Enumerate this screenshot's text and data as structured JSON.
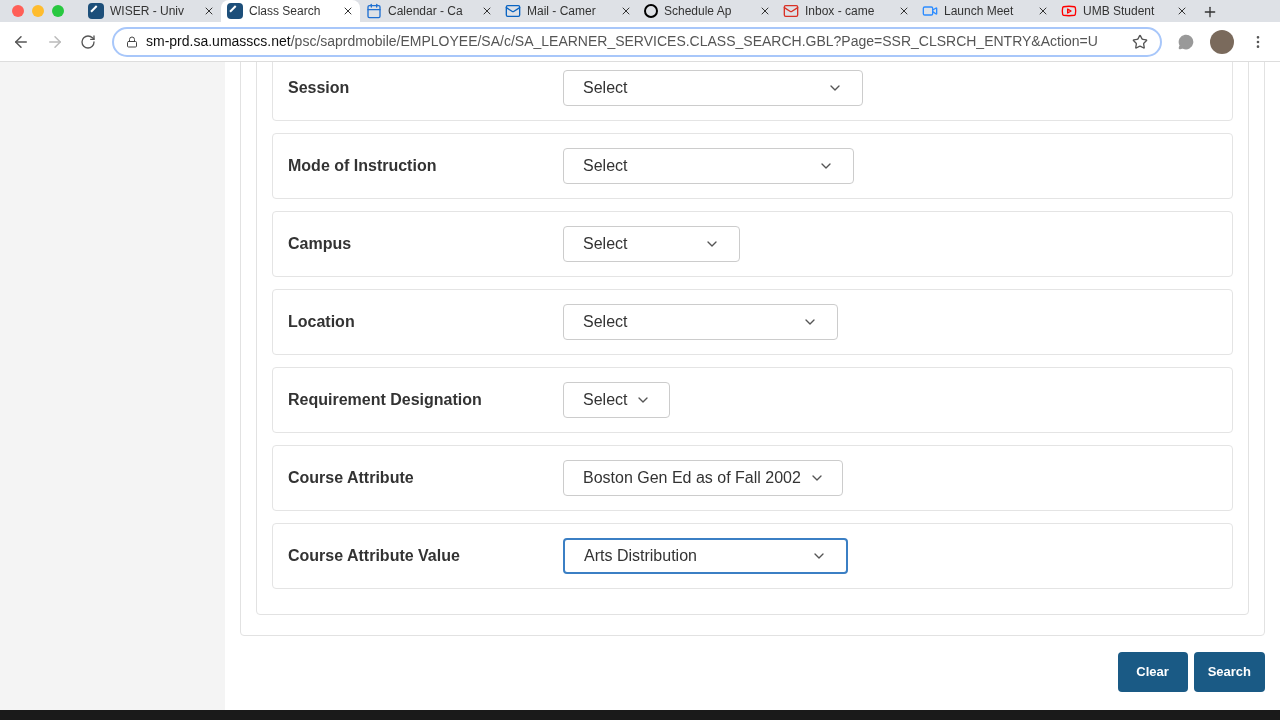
{
  "browser": {
    "tabs": [
      {
        "title": "WISER - Univ",
        "selected": false
      },
      {
        "title": "Class Search",
        "selected": true
      },
      {
        "title": "Calendar - Ca",
        "selected": false
      },
      {
        "title": "Mail - Camer",
        "selected": false
      },
      {
        "title": "Schedule Ap",
        "selected": false
      },
      {
        "title": "Inbox - came",
        "selected": false
      },
      {
        "title": "Launch Meet",
        "selected": false
      },
      {
        "title": "UMB Student",
        "selected": false
      }
    ],
    "url_host": "sm-prd.sa.umasscs.net",
    "url_path": "/psc/saprdmobile/EMPLOYEE/SA/c/SA_LEARNER_SERVICES.CLASS_SEARCH.GBL?Page=SSR_CLSRCH_ENTRY&Action=U"
  },
  "fields": [
    {
      "label": "Session",
      "value": "Select",
      "focused": false
    },
    {
      "label": "Mode of Instruction",
      "value": "Select",
      "focused": false
    },
    {
      "label": "Campus",
      "value": "Select",
      "focused": false
    },
    {
      "label": "Location",
      "value": "Select",
      "focused": false
    },
    {
      "label": "Requirement Designation",
      "value": "Select",
      "focused": false
    },
    {
      "label": "Course Attribute",
      "value": "Boston Gen Ed as of Fall 2002",
      "focused": false
    },
    {
      "label": "Course Attribute Value",
      "value": "Arts Distribution",
      "focused": true
    }
  ],
  "buttons": [
    "Clear",
    "Search"
  ]
}
